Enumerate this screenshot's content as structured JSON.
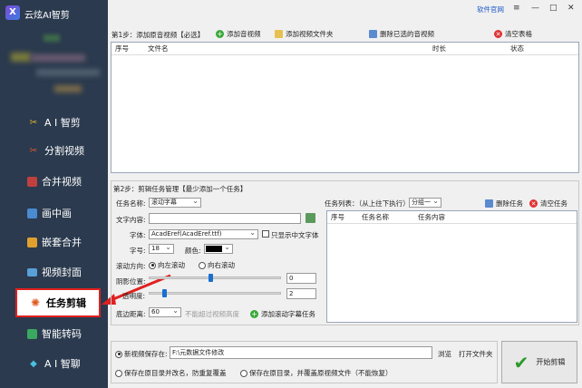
{
  "app": {
    "title": "云炫AI智剪",
    "logo_letter": "X"
  },
  "topbar": {
    "website_link": "软件官网",
    "min": "—",
    "max": "□",
    "close": "✕"
  },
  "sidebar": {
    "items": [
      {
        "label": "A I 智剪",
        "icon": "ai-scissors-icon"
      },
      {
        "label": "分割视频",
        "icon": "split-video-icon"
      },
      {
        "label": "合并视频",
        "icon": "merge-video-icon"
      },
      {
        "label": "画中画",
        "icon": "picture-in-picture-icon"
      },
      {
        "label": "嵌套合并",
        "icon": "nested-merge-icon"
      },
      {
        "label": "视频封面",
        "icon": "video-cover-icon"
      },
      {
        "label": "任务剪辑",
        "icon": "task-edit-icon",
        "active": true
      },
      {
        "label": "智能转码",
        "icon": "smart-transcode-icon"
      },
      {
        "label": "A I 智聊",
        "icon": "ai-chat-icon"
      }
    ]
  },
  "step1": {
    "label": "第1步：添加原音视频【必选】",
    "buttons": {
      "add_audio_video": "添加音视频",
      "add_folder": "添加视频文件夹",
      "delete_selected": "删除已选的音视频",
      "clear_table": "清空表格"
    },
    "columns": [
      "序号",
      "文件名",
      "时长",
      "状态"
    ]
  },
  "step2": {
    "label": "第2步：剪辑任务管理【最少添加一个任务】",
    "task_name_label": "任务名称:",
    "task_name_value": "滚动字幕",
    "text_content_label": "文字内容:",
    "text_content_value": "",
    "font_label": "字体:",
    "font_value": "AcadEref(AcadEref.ttf)",
    "chinese_only_label": "只显示中文字体",
    "size_label": "字号:",
    "size_value": "18",
    "color_label": "颜色:",
    "color_value": "#000000",
    "scroll_dir_label": "滚动方向:",
    "scroll_left": "向左滚动",
    "scroll_right": "向右滚动",
    "shadow_label": "阴影位置:",
    "shadow_value": "0",
    "shadow_level": 0.47,
    "opacity_label": "透明度:",
    "opacity_value": "2",
    "opacity_level": 0.1,
    "bottom_margin_label": "底边距离:",
    "bottom_margin_value": "60",
    "bottom_margin_hint": "不能超过视频高度",
    "add_task_button": "添加滚动字幕任务"
  },
  "task_list": {
    "label": "任务列表：（从上往下执行）",
    "group_value": "分组一",
    "delete_task": "删除任务",
    "clear_task": "清空任务",
    "columns": [
      "序号",
      "任务名称",
      "任务内容"
    ]
  },
  "output": {
    "new_save_label": "新视频保存在:",
    "save_path": "F:\\元数据文件修改",
    "browse": "浏览",
    "open_folder": "打开文件夹",
    "option_rename": "保存在原目录并改名，防重复覆盖",
    "option_overwrite": "保存在原目录，并覆盖原视频文件（不能恢复）",
    "start_button": "开始剪辑"
  },
  "colors": {
    "sidebar_bg": "#2b3a4e",
    "accent_red": "#e02020",
    "link_blue": "#1a56c8",
    "slider_blue": "#1a6fd0",
    "start_check": "#2a9a2a"
  }
}
